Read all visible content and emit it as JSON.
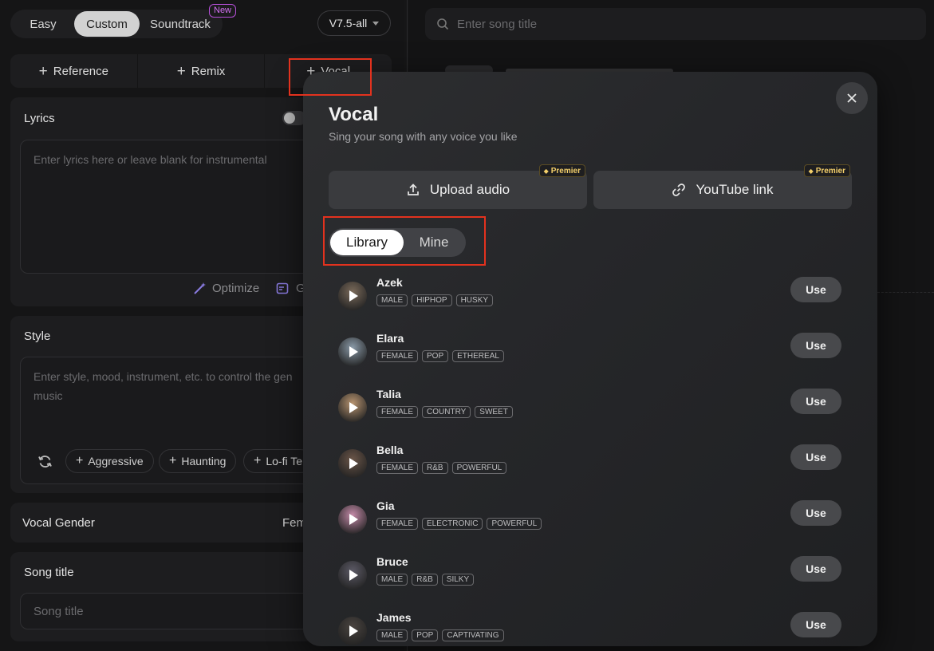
{
  "mode_tabs": {
    "easy": "Easy",
    "custom": "Custom",
    "soundtrack": "Soundtrack",
    "new_badge": "New"
  },
  "version": "V7.5-all",
  "add_buttons": {
    "reference": "Reference",
    "remix": "Remix",
    "vocal": "Vocal"
  },
  "lyrics": {
    "title": "Lyrics",
    "placeholder": "Enter lyrics here or leave blank for instrumental",
    "optimize": "Optimize",
    "generate": "G"
  },
  "style": {
    "title": "Style",
    "placeholder_line1": "Enter style, mood, instrument, etc. to control the gen",
    "placeholder_line2": "music",
    "chips": [
      "Aggressive",
      "Haunting",
      "Lo-fi Te"
    ]
  },
  "vocal_gender": {
    "title": "Vocal Gender",
    "value": "Fem"
  },
  "song_title": {
    "title": "Song title",
    "placeholder": "Song title"
  },
  "search": {
    "placeholder": "Enter song title"
  },
  "modal": {
    "title": "Vocal",
    "subtitle": "Sing your song with any voice you like",
    "upload_label": "Upload audio",
    "youtube_label": "YouTube link",
    "premium_label": "Premier",
    "tab_library": "Library",
    "tab_mine": "Mine",
    "use_label": "Use",
    "voices": [
      {
        "name": "Azek",
        "tags": [
          "MALE",
          "HIPHOP",
          "HUSKY"
        ],
        "color": "#7a6a5a"
      },
      {
        "name": "Elara",
        "tags": [
          "FEMALE",
          "POP",
          "ETHEREAL"
        ],
        "color": "#8a9aa8"
      },
      {
        "name": "Talia",
        "tags": [
          "FEMALE",
          "COUNTRY",
          "SWEET"
        ],
        "color": "#b89470"
      },
      {
        "name": "Bella",
        "tags": [
          "FEMALE",
          "R&B",
          "POWERFUL"
        ],
        "color": "#6a5548"
      },
      {
        "name": "Gia",
        "tags": [
          "FEMALE",
          "ELECTRONIC",
          "POWERFUL"
        ],
        "color": "#c48aa8"
      },
      {
        "name": "Bruce",
        "tags": [
          "MALE",
          "R&B",
          "SILKY"
        ],
        "color": "#5c5a66"
      },
      {
        "name": "James",
        "tags": [
          "MALE",
          "POP",
          "CAPTIVATING"
        ],
        "color": "#4a4440"
      }
    ]
  }
}
